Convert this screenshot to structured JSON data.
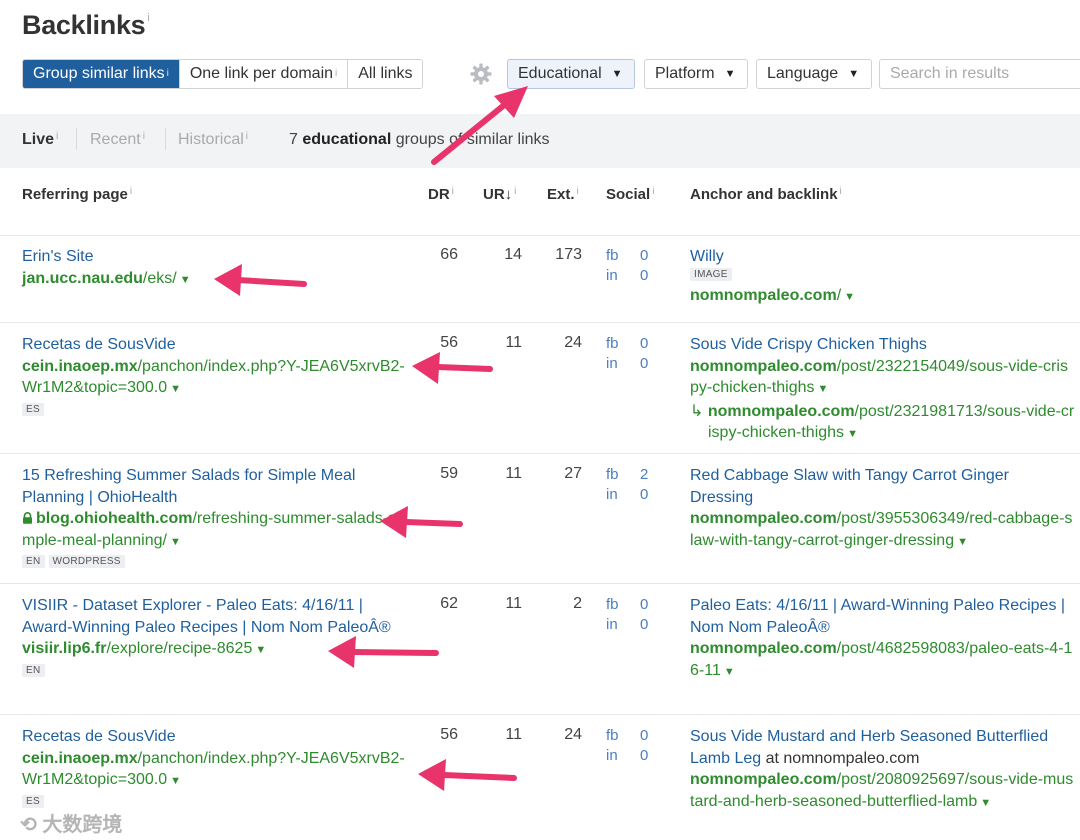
{
  "header": {
    "title": "Backlinks",
    "title_info": "i"
  },
  "filters": {
    "group_similar": "Group similar links",
    "one_per_domain": "One link per domain",
    "all_links": "All links",
    "info": "i",
    "educational": "Educational",
    "platform": "Platform",
    "language": "Language",
    "caret": "▼",
    "search_placeholder": "Search in results"
  },
  "tabs": {
    "live": "Live",
    "recent": "Recent",
    "historical": "Historical",
    "info": "i",
    "summary_count": "7",
    "summary_bold": "educational",
    "summary_rest": "groups of similar links"
  },
  "columns": {
    "referring_page": "Referring page",
    "dr": "DR",
    "ur": "UR",
    "ur_sort": "↓",
    "ext": "Ext.",
    "social": "Social",
    "anchor": "Anchor and backlink",
    "info": "i"
  },
  "social_labels": {
    "fb": "fb",
    "in": "in"
  },
  "rows": [
    {
      "title": "Erin's Site",
      "domain": "jan.ucc.nau.edu",
      "path": "/eks/",
      "dr": "66",
      "ur": "14",
      "ext": "173",
      "fb": "0",
      "in": "0",
      "anchor": "Willy",
      "anchor_tag": "IMAGE",
      "target_domain": "nomnompaleo.com",
      "target_path": "/"
    },
    {
      "title": "Recetas de SousVide",
      "domain": "cein.inaoep.mx",
      "path": "/panchon/index.php?Y-JEA6V5xrvB2-Wr1M2&topic=300.0",
      "tags": [
        "ES"
      ],
      "dr": "56",
      "ur": "11",
      "ext": "24",
      "fb": "0",
      "in": "0",
      "anchor": "Sous Vide Crispy Chicken Thighs",
      "target_domain": "nomnompaleo.com",
      "target_path": "/post/2322154049/sous-vide-crispy-chicken-thighs",
      "redirect_arrow": "↳",
      "redirect_domain": "nomnompaleo.com",
      "redirect_path": "/post/2321981713/sous-vide-crispy-chicken-thighs"
    },
    {
      "title": "15 Refreshing Summer Salads for Simple Meal Planning | OhioHealth",
      "domain": "blog.ohiohealth.com",
      "path": "/refreshing-summer-salads-simple-meal-planning/",
      "tags": [
        "EN",
        "WORDPRESS"
      ],
      "dr": "59",
      "ur": "11",
      "ext": "27",
      "fb": "2",
      "in": "0",
      "anchor": "Red Cabbage Slaw with Tangy Carrot Ginger Dressing",
      "target_domain": "nomnompaleo.com",
      "target_path": "/post/3955306349/red-cabbage-slaw-with-tangy-carrot-ginger-dressing"
    },
    {
      "title": "VISIIR - Dataset Explorer - Paleo Eats: 4/16/11 | Award-Winning Paleo Recipes | Nom Nom PaleoÂ®",
      "domain": "visiir.lip6.fr",
      "path": "/explore/recipe-8625",
      "tags": [
        "EN"
      ],
      "dr": "62",
      "ur": "11",
      "ext": "2",
      "fb": "0",
      "in": "0",
      "anchor": "Paleo Eats: 4/16/11 | Award-Winning Paleo Recipes | Nom Nom PaleoÂ®",
      "target_domain": "nomnompaleo.com",
      "target_path": "/post/4682598083/paleo-eats-4-16-11"
    },
    {
      "title": "Recetas de SousVide",
      "domain": "cein.inaoep.mx",
      "path": "/panchon/index.php?Y-JEA6V5xrvB2-Wr1M2&topic=300.0",
      "tags": [
        "ES"
      ],
      "dr": "56",
      "ur": "11",
      "ext": "24",
      "fb": "0",
      "in": "0",
      "anchor": "Sous Vide Mustard and Herb Seasoned Butterflied Lamb Leg",
      "anchor_suffix": " at nomnompaleo.com",
      "target_domain": "nomnompaleo.com",
      "target_path": "/post/2080925697/sous-vide-mustard-and-herb-seasoned-butterflied-lamb"
    }
  ],
  "watermark": "大数跨境",
  "colors": {
    "accent": "#1f5f9e",
    "url_green": "#2e8b2e",
    "annotation_arrow": "#e8336b"
  }
}
